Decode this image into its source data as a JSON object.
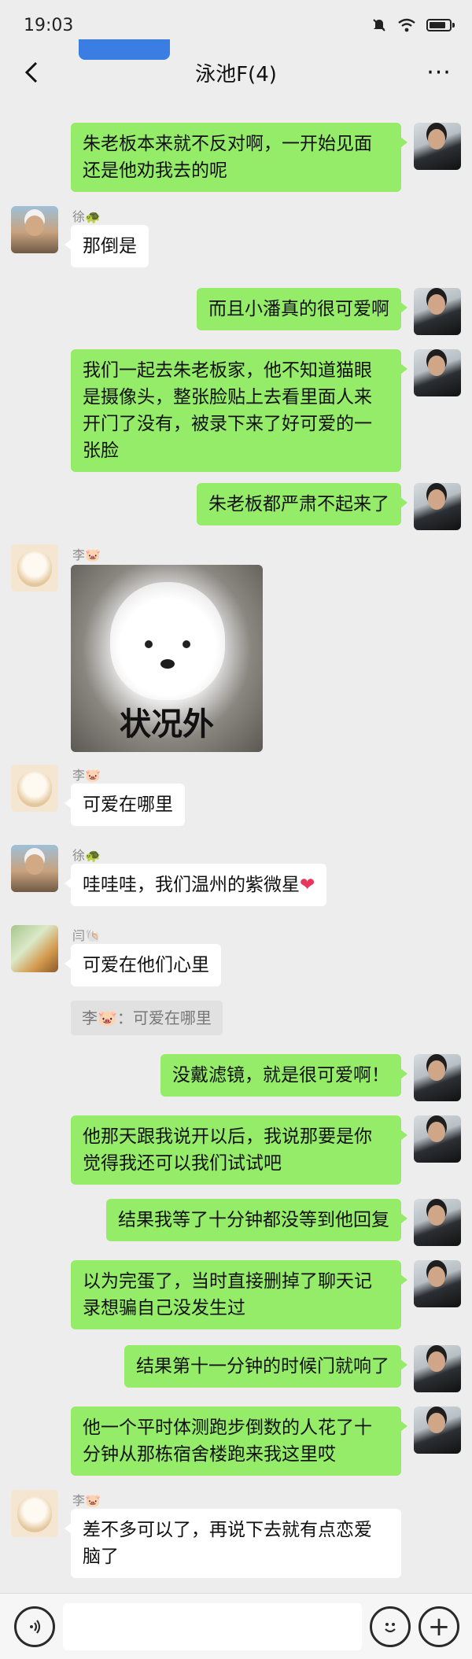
{
  "status_bar": {
    "time": "19:03",
    "icons": [
      "mute-icon",
      "wifi-icon",
      "battery-icon"
    ]
  },
  "header": {
    "title": "泳池F(4)",
    "back_icon": "chevron-left-icon",
    "more_label": "···"
  },
  "colors": {
    "outgoing_bubble": "#95ec69",
    "incoming_bubble": "#ffffff",
    "background": "#ededed",
    "heart": "#e8375b"
  },
  "messages": [
    {
      "dir": "out",
      "text": "朱老板本来就不反对啊，一开始见面还是他劝我去的呢"
    },
    {
      "dir": "in",
      "sender": "徐🐢",
      "text": "那倒是"
    },
    {
      "dir": "out",
      "text": "而且小潘真的很可爱啊"
    },
    {
      "dir": "out",
      "text": "我们一起去朱老板家，他不知道猫眼是摄像头，整张脸贴上去看里面人来开门了没有，被录下来了好可爱的一张脸"
    },
    {
      "dir": "out",
      "text": "朱老板都严肃不起来了"
    },
    {
      "dir": "in",
      "sender": "李🐷",
      "sticker_caption": "状况外"
    },
    {
      "dir": "in",
      "sender": "李🐷",
      "text": "可爱在哪里"
    },
    {
      "dir": "in",
      "sender": "徐🐢",
      "text": "哇哇哇，我们温州的紫微星",
      "emoji": "❤"
    },
    {
      "dir": "in",
      "sender": "闫🐚",
      "text": "可爱在他们心里",
      "quote": "李🐷：可爱在哪里"
    },
    {
      "dir": "out",
      "text": "没戴滤镜，就是很可爱啊！"
    },
    {
      "dir": "out",
      "text": "他那天跟我说开以后，我说那要是你觉得我还可以我们试试吧"
    },
    {
      "dir": "out",
      "text": "结果我等了十分钟都没等到他回复"
    },
    {
      "dir": "out",
      "text": "以为完蛋了，当时直接删掉了聊天记录想骗自己没发生过"
    },
    {
      "dir": "out",
      "text": "结果第十一分钟的时候门就响了"
    },
    {
      "dir": "out",
      "text": "他一个平时体测跑步倒数的人花了十分钟从那栋宿舍楼跑来我这里哎"
    },
    {
      "dir": "in",
      "sender": "李🐷",
      "text": "差不多可以了，再说下去就有点恋爱脑了"
    }
  ],
  "input_bar": {
    "voice_icon": "voice-icon",
    "emoji_icon": "emoji-icon",
    "plus_label": "+"
  }
}
